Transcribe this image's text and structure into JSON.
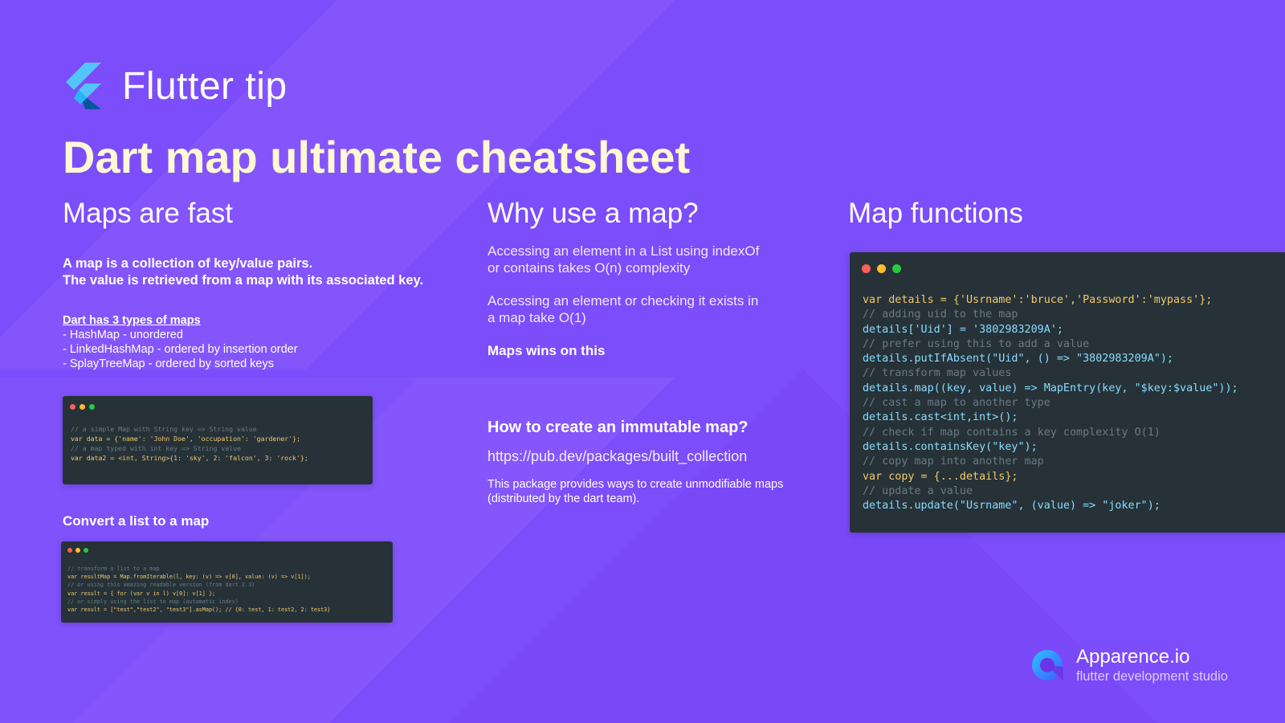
{
  "header": {
    "title": "Flutter tip"
  },
  "main_title": "Dart map ultimate cheatsheet",
  "col1": {
    "heading": "Maps are fast",
    "intro_line1": "A map is a collection of key/value pairs.",
    "intro_line2": "The value is retrieved from a map with its associated key.",
    "types_title": "Dart has 3 types of maps",
    "types": [
      "- HashMap - unordered",
      "- LinkedHashMap - ordered by insertion order",
      "- SplayTreeMap - ordered by sorted keys"
    ],
    "convert_title": "Convert a list to a map"
  },
  "col2": {
    "heading": "Why use a map?",
    "p1_line1": "Accessing an element in a List using indexOf",
    "p1_line2": "or contains takes O(n) complexity",
    "p2_line1": "Accessing an element or checking it exists in",
    "p2_line2": "a map take O(1)",
    "wins": "Maps wins on this",
    "immutable_title": "How to create an immutable map?",
    "link": "https://pub.dev/packages/built_collection",
    "desc_line1": "This package provides ways to create unmodifiable maps",
    "desc_line2": "(distributed by the dart team)."
  },
  "col3": {
    "heading": "Map functions"
  },
  "code_samples": {
    "small1": [
      "// a simple Map with String key => String value",
      "var data = {'name': 'John Doe', 'occupation': 'gardener'};",
      "// a map typed with int key => String value",
      "var data2 = <int, String>{1: 'sky', 2: 'falcon', 3: 'rock'};"
    ],
    "small2": [
      "// transform a list to a map",
      "var resultMap = Map.fromIterable(l, key: (v) => v[0], value: (v) => v[1]);",
      "// or using this amazing readable version (from dart 2.3)",
      "var result = { for (var v in l) v[0]: v[1] };",
      "// or simply using the list to map (automatic index)",
      "var result = [\"test\",\"test2\", \"test3\"].asMap(); // {0: test, 1: test2, 2: test3}"
    ],
    "large": [
      "var details = {'Usrname':'bruce','Password':'mypass'};",
      "// adding uid to the map",
      "details['Uid'] = '3802983209A';",
      "// prefer using this to add a value",
      "details.putIfAbsent(\"Uid\", () => \"3802983209A\");",
      "// transform map values",
      "details.map((key, value) => MapEntry(key, \"$key:$value\"));",
      "// cast a map to another type",
      "details.cast<int,int>();",
      "// check if map contains a key complexity O(1)",
      "details.containsKey(\"key\");",
      "// copy map into another map",
      "var copy = {...details};",
      "// update a value",
      "details.update(\"Usrname\", (value) => \"joker\");"
    ]
  },
  "brand": {
    "name": "Apparence.io",
    "tagline": "flutter development studio"
  },
  "colors": {
    "background": "#7c4dfa",
    "title": "#fff8d4",
    "code_bg": "#263238",
    "dot_red": "#ff5f56",
    "dot_yellow": "#ffbd2e",
    "dot_green": "#27c93f"
  }
}
